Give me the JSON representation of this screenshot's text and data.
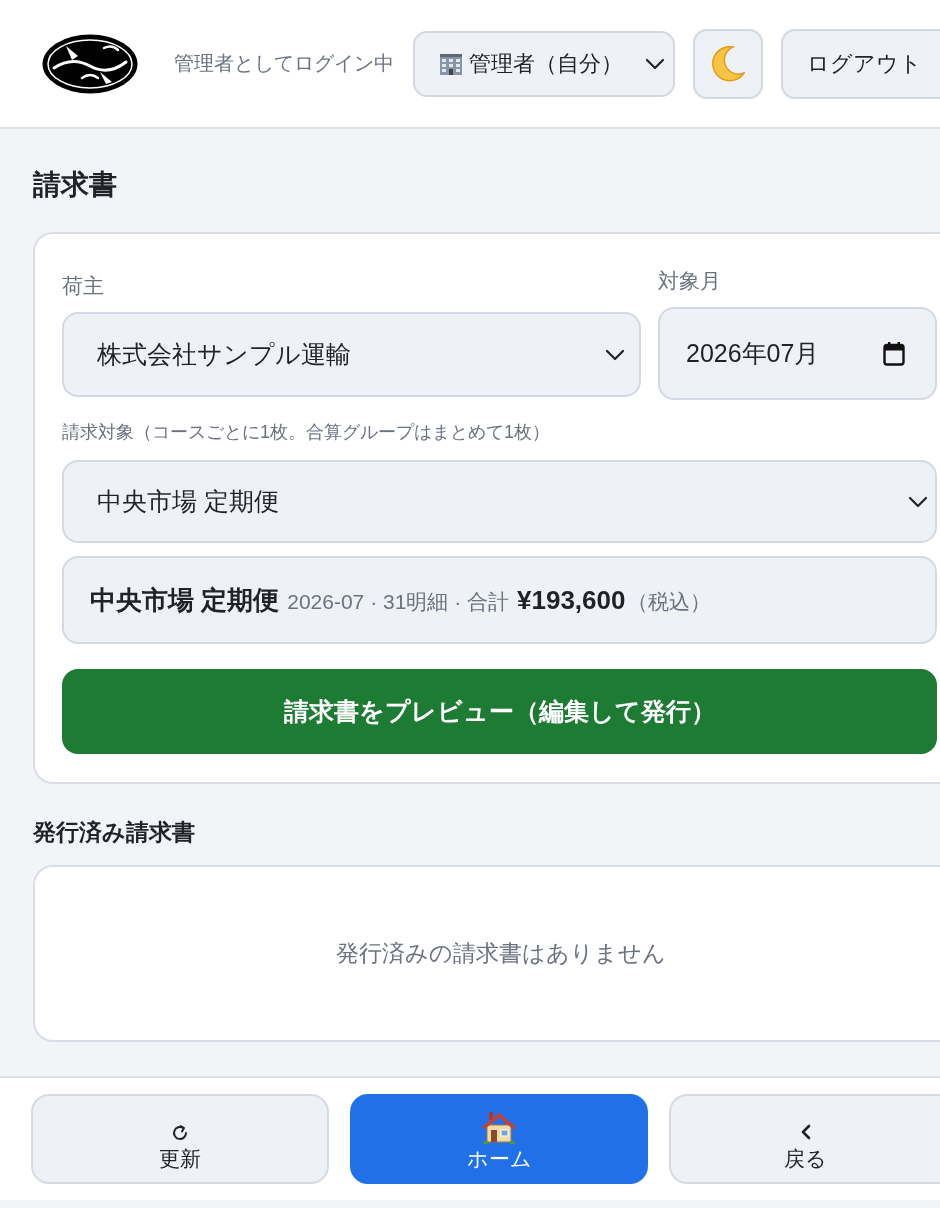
{
  "header": {
    "login_status": "管理者としてログイン中",
    "role_select": {
      "value": "管理者（自分）"
    },
    "logout_button": "ログアウト"
  },
  "page_title": "請求書",
  "form": {
    "shipper": {
      "label": "荷主",
      "value": "株式会社サンプル運輸"
    },
    "month": {
      "label": "対象月",
      "value": "2026年07月"
    },
    "target": {
      "label": "請求対象（コースごとに1枚。合算グループはまとめて1枚）",
      "value": "中央市場 定期便"
    },
    "summary": {
      "name": "中央市場 定期便",
      "detail": "2026-07 · 31明細 · 合計",
      "total": "¥193,600",
      "tax_note": "（税込）"
    },
    "preview_button": "請求書をプレビュー（編集して発行）"
  },
  "issued": {
    "title": "発行済み請求書",
    "empty_message": "発行済みの請求書はありません"
  },
  "bottom_nav": [
    {
      "kind": "refresh",
      "label": "更新",
      "selected": false
    },
    {
      "kind": "home",
      "label": "ホーム",
      "selected": true
    },
    {
      "kind": "back",
      "label": "戻る",
      "selected": false
    }
  ]
}
